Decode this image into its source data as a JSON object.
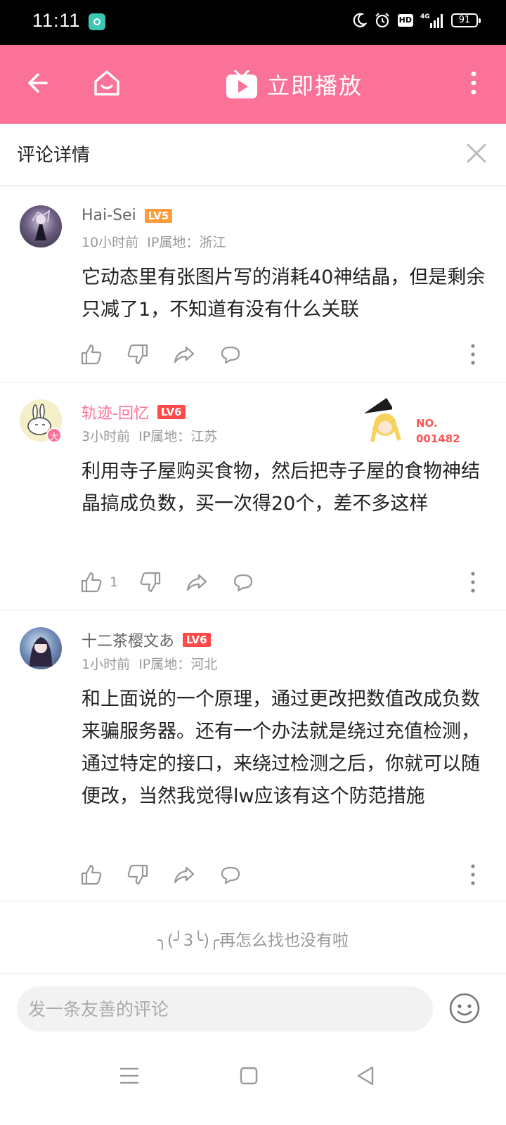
{
  "status_bar": {
    "time": "11:11",
    "network": "4G",
    "hd": "HD",
    "battery": "91"
  },
  "topbar": {
    "play_label": "立即播放"
  },
  "detail": {
    "title": "评论详情"
  },
  "comments": [
    {
      "username": "Hai-Sei",
      "level": "LV5",
      "time": "10小时前",
      "ip": "IP属地：浙江",
      "text": "它动态里有张图片写的消耗40神结晶，但是剩余只减了1，不知道有没有什么关联",
      "likes": ""
    },
    {
      "username": "轨迹-回忆",
      "level": "LV6",
      "time": "3小时前",
      "ip": "IP属地：江苏",
      "text": "利用寺子屋购买食物，然后把寺子屋的食物神结晶搞成负数，买一次得20个，差不多这样",
      "likes": "1",
      "avatar_badge": "大",
      "fan_badge": {
        "line1": "NO.",
        "line2": "001482"
      }
    },
    {
      "username": "十二茶樱文あ",
      "level": "LV6",
      "time": "1小时前",
      "ip": "IP属地：河北",
      "text": "和上面说的一个原理，通过更改把数值改成负数来骗服务器。还有一个办法就是绕过充值检测，通过特定的接口，来绕过检测之后，你就可以随便改，当然我觉得lw应该有这个防范措施",
      "likes": ""
    }
  ],
  "end_message": "╮(╯3╰)╭再怎么找也没有啦",
  "input": {
    "placeholder": "发一条友善的评论"
  },
  "colors": {
    "brand_pink": "#fb7299",
    "lv5": "#ff9c3b",
    "lv6": "#ff4a4a"
  }
}
